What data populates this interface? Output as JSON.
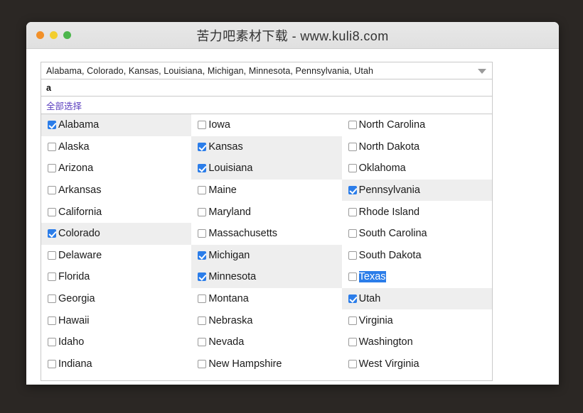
{
  "window": {
    "title": "苦力吧素材下载 - www.kuli8.com",
    "traffic_lights": [
      "close-red",
      "minimize-yellow",
      "zoom-green"
    ]
  },
  "multiselect": {
    "summary_text": "Alabama, Colorado, Kansas, Louisiana, Michigan, Minnesota, Pennsylvania, Utah",
    "caret_icon": "chevron-down-icon",
    "search_value": "a",
    "search_placeholder": "",
    "select_all_label": "全部选择",
    "selected_items": [
      "Alabama",
      "Colorado",
      "Kansas",
      "Louisiana",
      "Michigan",
      "Minnesota",
      "Pennsylvania",
      "Utah"
    ],
    "columns": [
      {
        "options": [
          {
            "label": "Alabama",
            "checked": true,
            "text_selected": false
          },
          {
            "label": "Alaska",
            "checked": false,
            "text_selected": false
          },
          {
            "label": "Arizona",
            "checked": false,
            "text_selected": false
          },
          {
            "label": "Arkansas",
            "checked": false,
            "text_selected": false
          },
          {
            "label": "California",
            "checked": false,
            "text_selected": false
          },
          {
            "label": "Colorado",
            "checked": true,
            "text_selected": false
          },
          {
            "label": "Delaware",
            "checked": false,
            "text_selected": false
          },
          {
            "label": "Florida",
            "checked": false,
            "text_selected": false
          },
          {
            "label": "Georgia",
            "checked": false,
            "text_selected": false
          },
          {
            "label": "Hawaii",
            "checked": false,
            "text_selected": false
          },
          {
            "label": "Idaho",
            "checked": false,
            "text_selected": false
          },
          {
            "label": "Indiana",
            "checked": false,
            "text_selected": false
          }
        ]
      },
      {
        "options": [
          {
            "label": "Iowa",
            "checked": false,
            "text_selected": false
          },
          {
            "label": "Kansas",
            "checked": true,
            "text_selected": false
          },
          {
            "label": "Louisiana",
            "checked": true,
            "text_selected": false
          },
          {
            "label": "Maine",
            "checked": false,
            "text_selected": false
          },
          {
            "label": "Maryland",
            "checked": false,
            "text_selected": false
          },
          {
            "label": "Massachusetts",
            "checked": false,
            "text_selected": false
          },
          {
            "label": "Michigan",
            "checked": true,
            "text_selected": false
          },
          {
            "label": "Minnesota",
            "checked": true,
            "text_selected": false
          },
          {
            "label": "Montana",
            "checked": false,
            "text_selected": false
          },
          {
            "label": "Nebraska",
            "checked": false,
            "text_selected": false
          },
          {
            "label": "Nevada",
            "checked": false,
            "text_selected": false
          },
          {
            "label": "New Hampshire",
            "checked": false,
            "text_selected": false
          }
        ]
      },
      {
        "options": [
          {
            "label": "North Carolina",
            "checked": false,
            "text_selected": false
          },
          {
            "label": "North Dakota",
            "checked": false,
            "text_selected": false
          },
          {
            "label": "Oklahoma",
            "checked": false,
            "text_selected": false
          },
          {
            "label": "Pennsylvania",
            "checked": true,
            "text_selected": false
          },
          {
            "label": "Rhode Island",
            "checked": false,
            "text_selected": false
          },
          {
            "label": "South Carolina",
            "checked": false,
            "text_selected": false
          },
          {
            "label": "South Dakota",
            "checked": false,
            "text_selected": false
          },
          {
            "label": "Texas",
            "checked": false,
            "text_selected": true
          },
          {
            "label": "Utah",
            "checked": true,
            "text_selected": false
          },
          {
            "label": "Virginia",
            "checked": false,
            "text_selected": false
          },
          {
            "label": "Washington",
            "checked": false,
            "text_selected": false
          },
          {
            "label": "West Virginia",
            "checked": false,
            "text_selected": false
          }
        ]
      }
    ]
  },
  "colors": {
    "desktop_background": "#2b2724",
    "titlebar": "#e4e4e4",
    "accent_checkbox": "#2b7de9",
    "selection_highlight": "#2b7de9",
    "row_checked_background": "#eeeeee",
    "link": "#5b3fbf",
    "border": "#c9c9c9"
  }
}
